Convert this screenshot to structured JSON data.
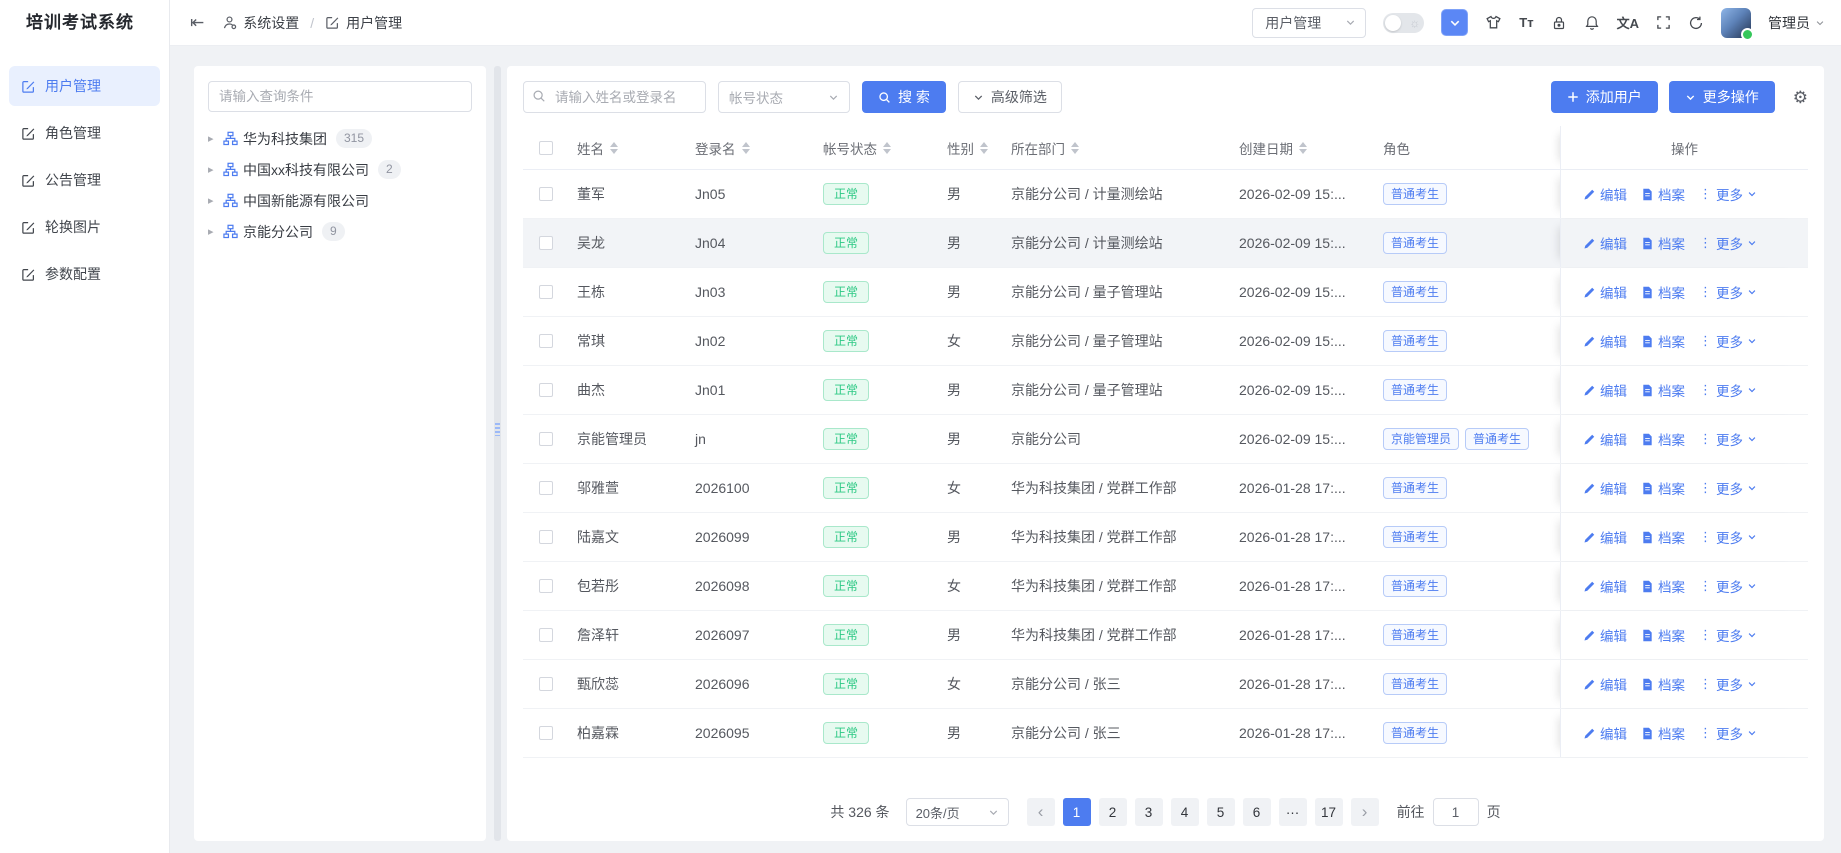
{
  "app": {
    "title": "培训考试系统"
  },
  "colors": {
    "primary": "#4d7cf0",
    "success": "#2ec985",
    "content_bg": "#f0f2f5"
  },
  "icons": {
    "collapse": "⇤",
    "sun": "☼",
    "font_size": "Tᴛ",
    "translate": "文A",
    "gear": "⚙",
    "tree_caret": "▸",
    "more_vertical": "⋮",
    "prev": "‹",
    "next": "›"
  },
  "header": {
    "breadcrumb": {
      "separator": "/",
      "items": [
        {
          "label": "系统设置"
        },
        {
          "label": "用户管理"
        }
      ]
    },
    "workspace_select": {
      "value": "用户管理"
    },
    "user": {
      "name": "管理员"
    }
  },
  "sidebar": {
    "items": [
      {
        "label": "用户管理",
        "active": true
      },
      {
        "label": "角色管理",
        "active": false
      },
      {
        "label": "公告管理",
        "active": false
      },
      {
        "label": "轮换图片",
        "active": false
      },
      {
        "label": "参数配置",
        "active": false
      }
    ]
  },
  "tree_panel": {
    "search_placeholder": "请输入查询条件",
    "nodes": [
      {
        "label": "华为科技集团",
        "badge": "315"
      },
      {
        "label": "中国xx科技有限公司",
        "badge": "2"
      },
      {
        "label": "中国新能源有限公司",
        "badge": ""
      },
      {
        "label": "京能分公司",
        "badge": "9"
      }
    ]
  },
  "toolbar": {
    "search_placeholder": "请输入姓名或登录名",
    "status_select_placeholder": "帐号状态",
    "search_button": "搜 索",
    "advanced_filter_button": "高级筛选",
    "add_user_button": "添加用户",
    "more_actions_button": "更多操作"
  },
  "table": {
    "columns": [
      {
        "label": "姓名",
        "sortable": true
      },
      {
        "label": "登录名",
        "sortable": true
      },
      {
        "label": "帐号状态",
        "sortable": true
      },
      {
        "label": "性别",
        "sortable": true
      },
      {
        "label": "所在部门",
        "sortable": true
      },
      {
        "label": "创建日期",
        "sortable": true
      },
      {
        "label": "角色",
        "sortable": false
      },
      {
        "label": "操作",
        "sortable": false
      }
    ],
    "actions": {
      "edit": "编辑",
      "archive": "档案",
      "more": "更多"
    },
    "rows": [
      {
        "name": "董军",
        "login": "Jn05",
        "status": "正常",
        "gender": "男",
        "dept": "京能分公司 / 计量测绘站",
        "date": "2026-02-09 15:...",
        "roles": [
          "普通考生"
        ],
        "highlight": false
      },
      {
        "name": "吴龙",
        "login": "Jn04",
        "status": "正常",
        "gender": "男",
        "dept": "京能分公司 / 计量测绘站",
        "date": "2026-02-09 15:...",
        "roles": [
          "普通考生"
        ],
        "highlight": true
      },
      {
        "name": "王栋",
        "login": "Jn03",
        "status": "正常",
        "gender": "男",
        "dept": "京能分公司 / 量子管理站",
        "date": "2026-02-09 15:...",
        "roles": [
          "普通考生"
        ],
        "highlight": false
      },
      {
        "name": "常琪",
        "login": "Jn02",
        "status": "正常",
        "gender": "女",
        "dept": "京能分公司 / 量子管理站",
        "date": "2026-02-09 15:...",
        "roles": [
          "普通考生"
        ],
        "highlight": false
      },
      {
        "name": "曲杰",
        "login": "Jn01",
        "status": "正常",
        "gender": "男",
        "dept": "京能分公司 / 量子管理站",
        "date": "2026-02-09 15:...",
        "roles": [
          "普通考生"
        ],
        "highlight": false
      },
      {
        "name": "京能管理员",
        "login": "jn",
        "status": "正常",
        "gender": "男",
        "dept": "京能分公司",
        "date": "2026-02-09 15:...",
        "roles": [
          "京能管理员",
          "普通考生"
        ],
        "highlight": false
      },
      {
        "name": "邬雅萱",
        "login": "2026100",
        "status": "正常",
        "gender": "女",
        "dept": "华为科技集团 / 党群工作部",
        "date": "2026-01-28 17:...",
        "roles": [
          "普通考生"
        ],
        "highlight": false
      },
      {
        "name": "陆嘉文",
        "login": "2026099",
        "status": "正常",
        "gender": "男",
        "dept": "华为科技集团 / 党群工作部",
        "date": "2026-01-28 17:...",
        "roles": [
          "普通考生"
        ],
        "highlight": false
      },
      {
        "name": "包若彤",
        "login": "2026098",
        "status": "正常",
        "gender": "女",
        "dept": "华为科技集团 / 党群工作部",
        "date": "2026-01-28 17:...",
        "roles": [
          "普通考生"
        ],
        "highlight": false
      },
      {
        "name": "詹泽轩",
        "login": "2026097",
        "status": "正常",
        "gender": "男",
        "dept": "华为科技集团 / 党群工作部",
        "date": "2026-01-28 17:...",
        "roles": [
          "普通考生"
        ],
        "highlight": false
      },
      {
        "name": "甄欣蕊",
        "login": "2026096",
        "status": "正常",
        "gender": "女",
        "dept": "京能分公司 / 张三",
        "date": "2026-01-28 17:...",
        "roles": [
          "普通考生"
        ],
        "highlight": false
      },
      {
        "name": "柏嘉霖",
        "login": "2026095",
        "status": "正常",
        "gender": "男",
        "dept": "京能分公司 / 张三",
        "date": "2026-01-28 17:...",
        "roles": [
          "普通考生"
        ],
        "highlight": false
      }
    ]
  },
  "pagination": {
    "total": "共 326 条",
    "page_size": "20条/页",
    "pages": [
      "1",
      "2",
      "3",
      "4",
      "5",
      "6",
      "···",
      "17"
    ],
    "active_page": "1",
    "ellipsis": "···",
    "goto_label": "前往",
    "goto_value": "1",
    "unit_label": "页"
  }
}
